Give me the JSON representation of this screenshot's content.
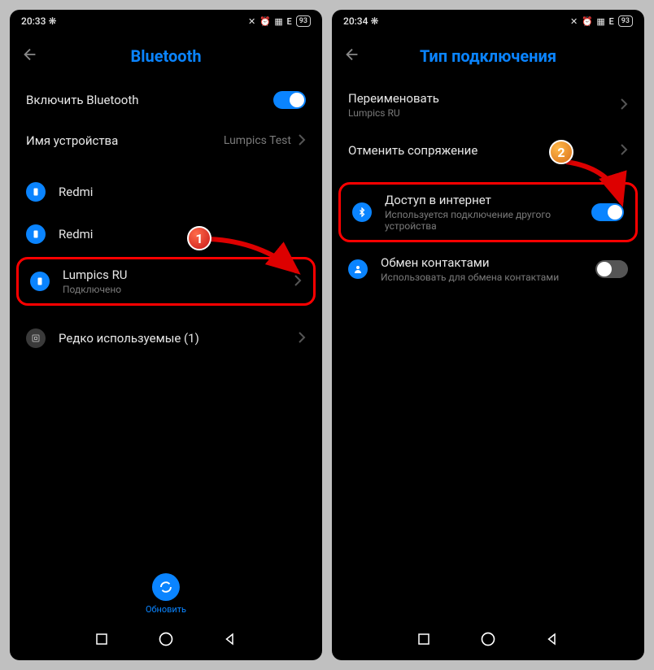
{
  "left": {
    "status": {
      "time": "20:33",
      "bt_glyph": "❋",
      "icons": "✕ ⏰ ▦ E",
      "battery": "93"
    },
    "title": "Bluetooth",
    "toggle_row": {
      "label": "Включить Bluetooth"
    },
    "name_row": {
      "label": "Имя устройства",
      "value": "Lumpics Test"
    },
    "devices": [
      {
        "name": "Redmi"
      },
      {
        "name": "Redmi"
      }
    ],
    "highlighted": {
      "name": "Lumpics RU",
      "status": "Подключено"
    },
    "rare_row": {
      "label": "Редко используемые (1)"
    },
    "refresh": "Обновить",
    "step": "1"
  },
  "right": {
    "status": {
      "time": "20:34",
      "bt_glyph": "❋",
      "icons": "✕ ⏰ ▦ E",
      "battery": "93"
    },
    "title": "Тип подключения",
    "rename": {
      "label": "Переименовать",
      "sub": "Lumpics RU"
    },
    "unpair": {
      "label": "Отменить сопряжение"
    },
    "internet": {
      "label": "Доступ в интернет",
      "sub": "Используется подключение другого устройства"
    },
    "contacts": {
      "label": "Обмен контактами",
      "sub": "Использовать для обмена контактами"
    },
    "step": "2"
  }
}
